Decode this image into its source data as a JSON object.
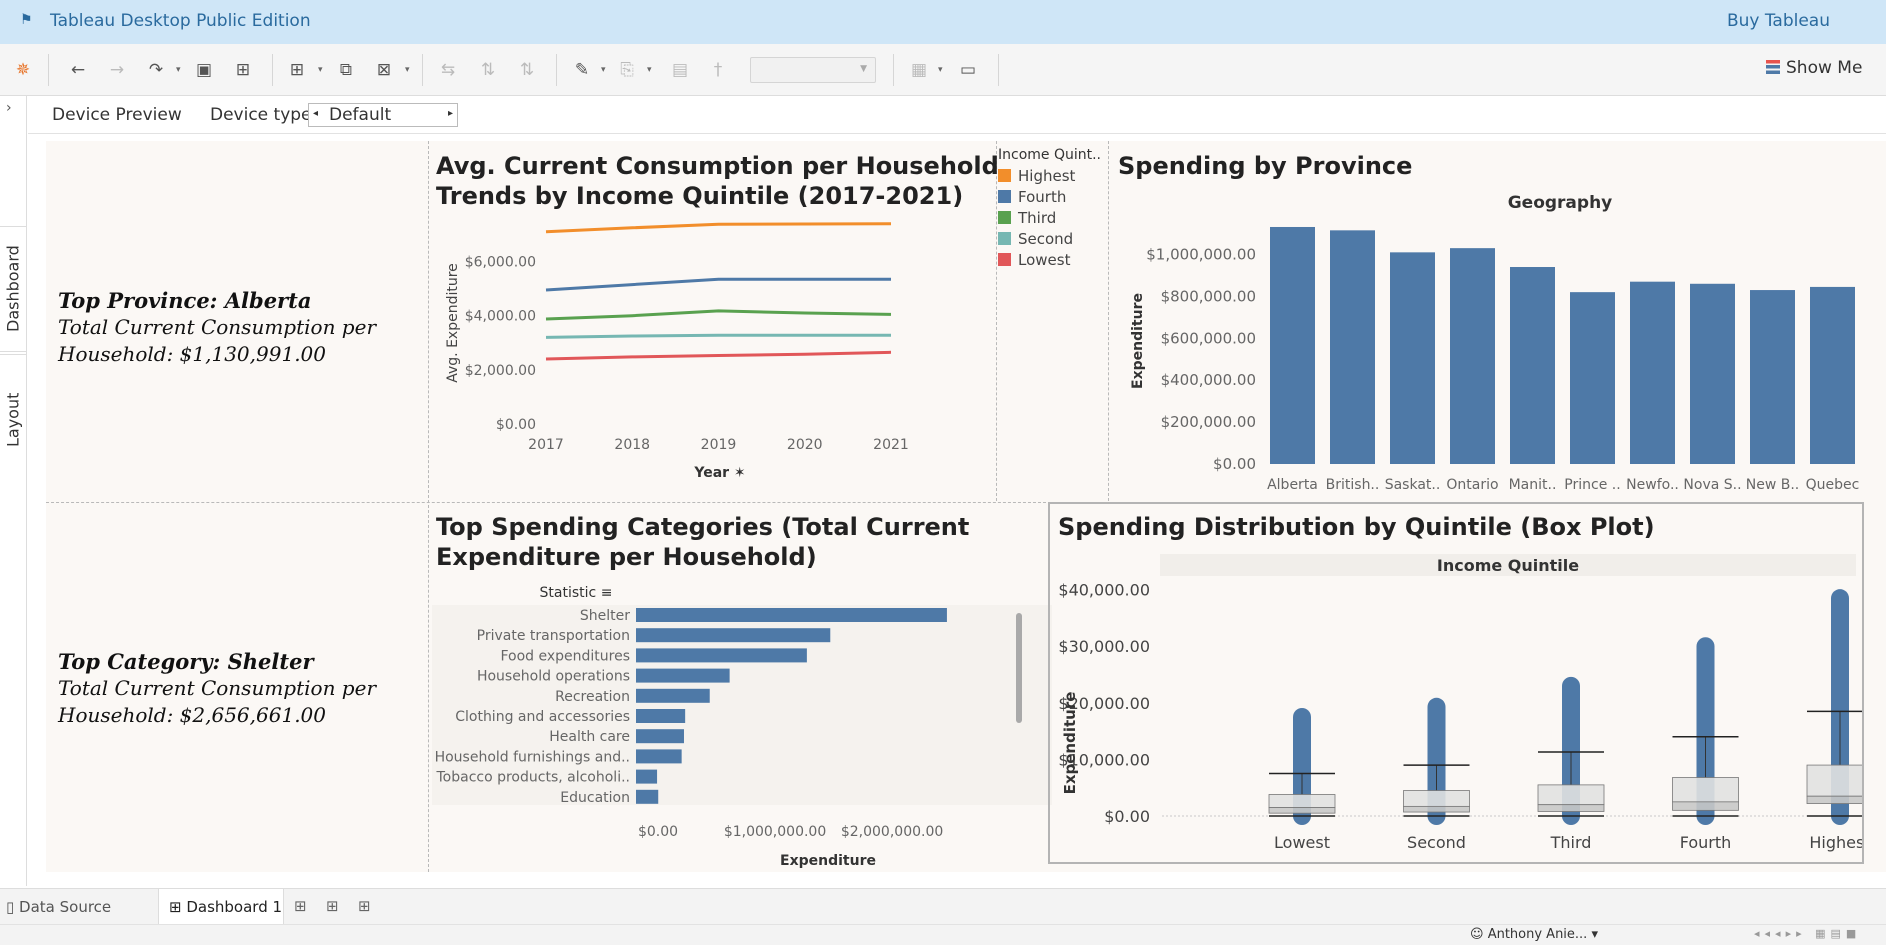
{
  "app": {
    "title": "Tableau Desktop Public Edition",
    "buy_label": "Buy Tableau",
    "show_me_label": "Show Me"
  },
  "device_bar": {
    "preview_label": "Device Preview",
    "type_label": "Device type",
    "type_value": "Default"
  },
  "sidebar": {
    "tabs": [
      "Dashboard",
      "Layout"
    ]
  },
  "kpi_province": {
    "heading": "Top Province: Alberta",
    "line1": "Total Current Consumption per",
    "line2": "Household: $1,130,991.00"
  },
  "kpi_category": {
    "heading": "Top Category: Shelter",
    "line1": "Total Current Consumption per",
    "line2": "Household: $2,656,661.00"
  },
  "line_chart": {
    "title_line1": "Avg. Current Consumption per Household",
    "title_line2": "Trends by Income Quintile (2017-2021)"
  },
  "province_chart": {
    "title": "Spending by Province"
  },
  "category_chart": {
    "title_line1": "Top Spending Categories (Total Current",
    "title_line2": "Expenditure per Household)"
  },
  "box_chart": {
    "title": "Spending Distribution by Quintile (Box Plot)"
  },
  "legend": {
    "title": "Income Quint..",
    "items": [
      {
        "label": "Highest",
        "color": "#f28e2b"
      },
      {
        "label": "Fourth",
        "color": "#4e79a7"
      },
      {
        "label": "Third",
        "color": "#59a14f"
      },
      {
        "label": "Second",
        "color": "#76b7b2"
      },
      {
        "label": "Lowest",
        "color": "#e15759"
      }
    ]
  },
  "tabs": {
    "data_source": "Data Source",
    "dashboard": "Dashboard 1"
  },
  "status": {
    "user": "Anthony  Anie..."
  },
  "chart_data": [
    {
      "type": "line",
      "xlabel": "Year",
      "ylabel": "Avg. Expenditure",
      "x": [
        "2017",
        "2018",
        "2019",
        "2020",
        "2021"
      ],
      "ylim": [
        0,
        7500
      ],
      "yticks": [
        "$0.00",
        "$2,000.00",
        "$4,000.00",
        "$6,000.00"
      ],
      "series": [
        {
          "name": "Highest",
          "color": "#f28e2b",
          "values": [
            7100,
            7250,
            7380,
            7390,
            7400
          ]
        },
        {
          "name": "Fourth",
          "color": "#4e79a7",
          "values": [
            4950,
            5150,
            5350,
            5350,
            5350
          ]
        },
        {
          "name": "Third",
          "color": "#59a14f",
          "values": [
            3880,
            4000,
            4180,
            4100,
            4050
          ]
        },
        {
          "name": "Second",
          "color": "#76b7b2",
          "values": [
            3200,
            3250,
            3280,
            3280,
            3280
          ]
        },
        {
          "name": "Lowest",
          "color": "#e15759",
          "values": [
            2400,
            2480,
            2530,
            2580,
            2650
          ]
        }
      ]
    },
    {
      "type": "bar",
      "header": "Geography",
      "ylabel": "Expenditure",
      "categories": [
        "Alberta",
        "British..",
        "Saskat..",
        "Ontario",
        "Manit..",
        "Prince ..",
        "Newfo..",
        "Nova S..",
        "New B..",
        "Quebec"
      ],
      "values": [
        1130991,
        1115000,
        1010000,
        1030000,
        940000,
        820000,
        870000,
        860000,
        830000,
        845000
      ],
      "ylim": [
        0,
        1150000
      ],
      "yticks": [
        "$0.00",
        "$200,000.00",
        "$400,000.00",
        "$600,000.00",
        "$800,000.00",
        "$1,000,000.00"
      ]
    },
    {
      "type": "bar",
      "orientation": "horizontal",
      "header": "Statistic",
      "xlabel": "Expenditure",
      "categories": [
        "Shelter",
        "Private transportation",
        "Food expenditures",
        "Household operations",
        "Recreation",
        "Clothing and accessories",
        "Health care",
        "Household furnishings and..",
        "Tobacco products, alcoholi..",
        "Education"
      ],
      "values": [
        2656661,
        1660000,
        1460000,
        800000,
        630000,
        420000,
        410000,
        390000,
        180000,
        190000
      ],
      "xlim": [
        0,
        2700000
      ],
      "xticks": [
        "$0.00",
        "$1,000,000.00",
        "$2,000,000.00"
      ]
    },
    {
      "type": "box",
      "header": "Income Quintile",
      "ylabel": "Expenditure",
      "categories": [
        "Lowest",
        "Second",
        "Third",
        "Fourth",
        "Highest"
      ],
      "ylim": [
        0,
        41000
      ],
      "yticks": [
        "$0.00",
        "$10,000.00",
        "$20,000.00",
        "$30,000.00",
        "$40,000.00"
      ],
      "boxes": [
        {
          "min": 0,
          "q1": 500,
          "median": 1500,
          "q3": 3800,
          "whisker_high": 7500,
          "max": 17500
        },
        {
          "min": 0,
          "q1": 700,
          "median": 1700,
          "q3": 4500,
          "whisker_high": 9000,
          "max": 19300
        },
        {
          "min": 0,
          "q1": 800,
          "median": 2000,
          "q3": 5500,
          "whisker_high": 11300,
          "max": 23000
        },
        {
          "min": 0,
          "q1": 1000,
          "median": 2500,
          "q3": 6800,
          "whisker_high": 14000,
          "max": 30000
        },
        {
          "min": 0,
          "q1": 2200,
          "median": 3500,
          "q3": 9000,
          "whisker_high": 18500,
          "max": 38500
        }
      ]
    }
  ]
}
